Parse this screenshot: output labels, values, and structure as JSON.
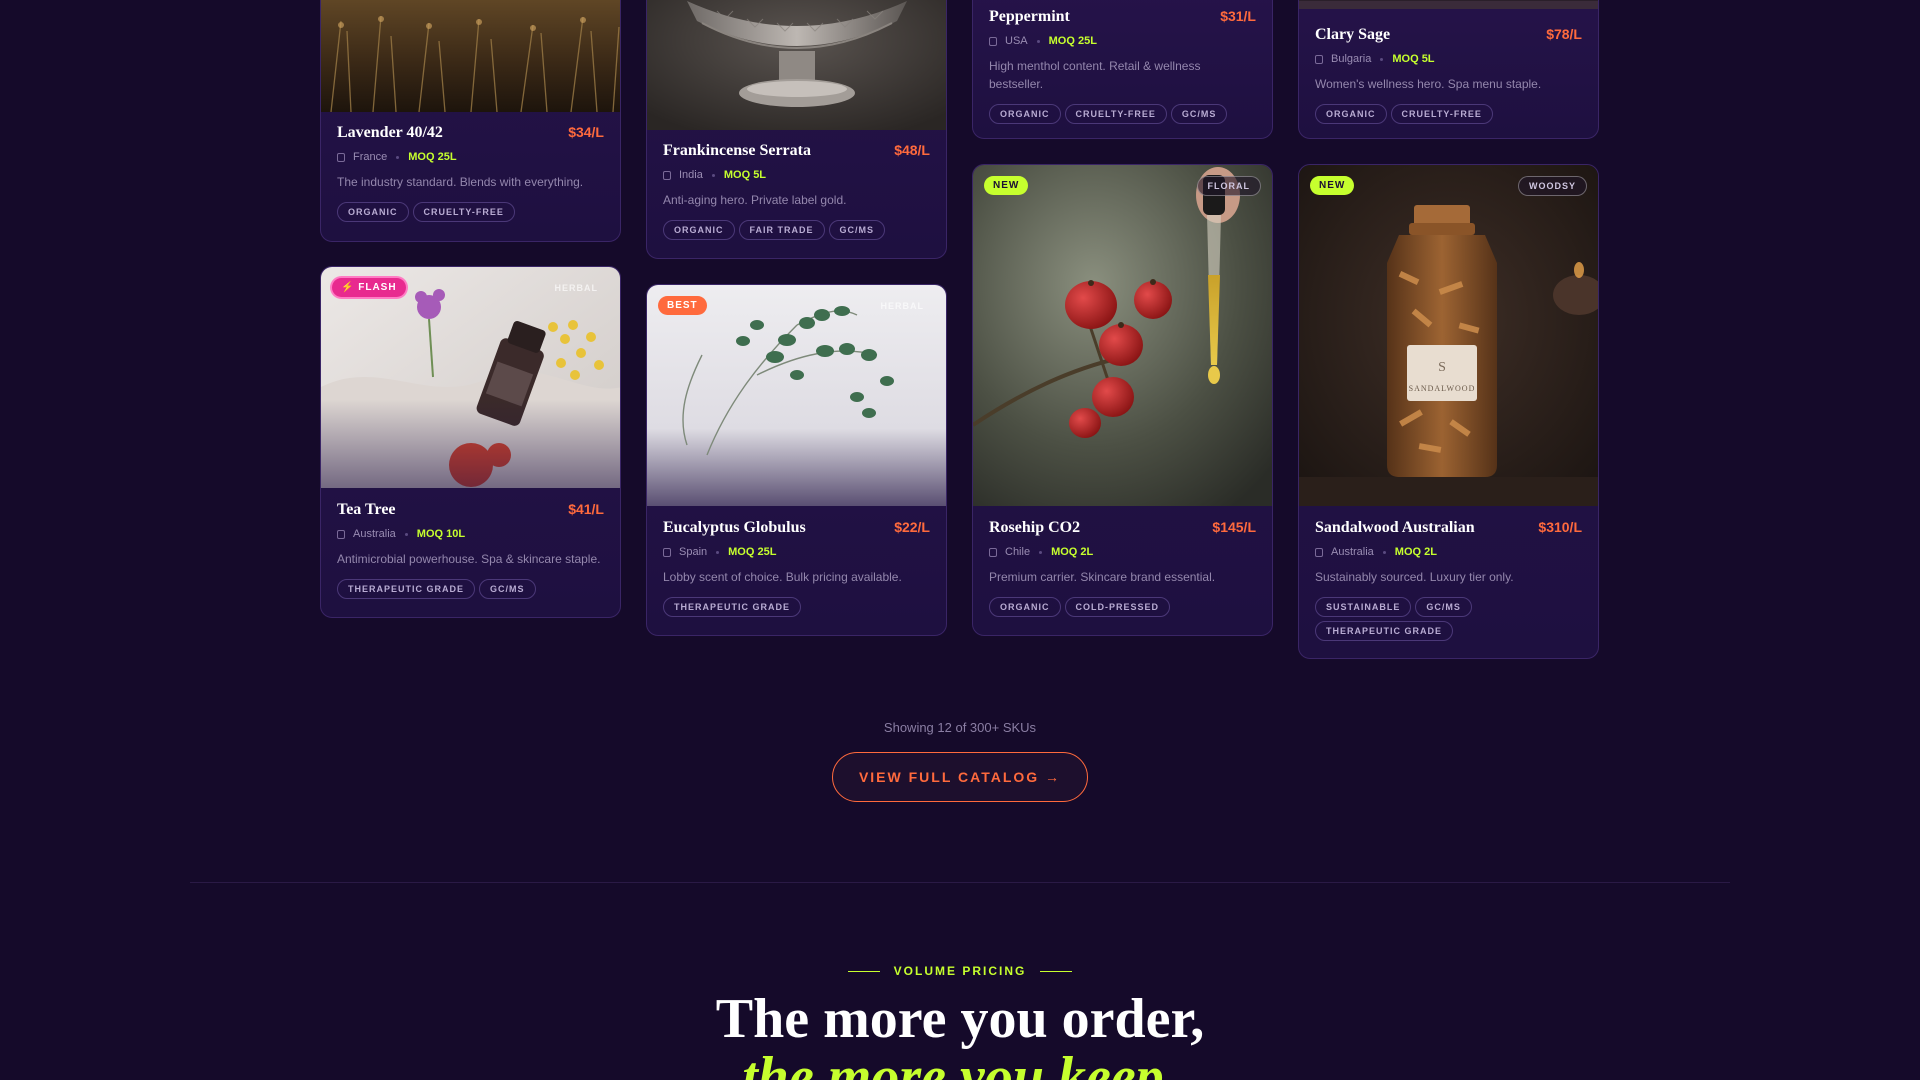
{
  "products": [
    {
      "name": "Lavender 40/42",
      "price": "$34/L",
      "origin": "France",
      "moq": "MOQ 25L",
      "desc": "The industry standard. Blends with everything.",
      "tags": [
        "ORGANIC",
        "CRUELTY-FREE"
      ]
    },
    {
      "name": "Frankincense Serrata",
      "price": "$48/L",
      "origin": "India",
      "moq": "MOQ 5L",
      "desc": "Anti-aging hero. Private label gold.",
      "tags": [
        "ORGANIC",
        "FAIR TRADE",
        "GC/MS"
      ]
    },
    {
      "name": "Peppermint",
      "price": "$31/L",
      "origin": "USA",
      "moq": "MOQ 25L",
      "desc": "High menthol content. Retail & wellness bestseller.",
      "tags": [
        "ORGANIC",
        "CRUELTY-FREE",
        "GC/MS"
      ]
    },
    {
      "name": "Clary Sage",
      "price": "$78/L",
      "origin": "Bulgaria",
      "moq": "MOQ 5L",
      "desc": "Women's wellness hero. Spa menu staple.",
      "tags": [
        "ORGANIC",
        "CRUELTY-FREE"
      ]
    },
    {
      "badge": "⚡ FLASH",
      "scent": "HERBAL",
      "name": "Tea Tree",
      "price": "$41/L",
      "origin": "Australia",
      "moq": "MOQ 10L",
      "desc": "Antimicrobial powerhouse. Spa & skincare staple.",
      "tags": [
        "THERAPEUTIC GRADE",
        "GC/MS"
      ]
    },
    {
      "badge": "BEST",
      "scent": "HERBAL",
      "name": "Eucalyptus Globulus",
      "price": "$22/L",
      "origin": "Spain",
      "moq": "MOQ 25L",
      "desc": "Lobby scent of choice. Bulk pricing available.",
      "tags": [
        "THERAPEUTIC GRADE"
      ]
    },
    {
      "badge": "NEW",
      "scent": "FLORAL",
      "name": "Rosehip CO2",
      "price": "$145/L",
      "origin": "Chile",
      "moq": "MOQ 2L",
      "desc": "Premium carrier. Skincare brand essential.",
      "tags": [
        "ORGANIC",
        "COLD-PRESSED"
      ]
    },
    {
      "badge": "NEW",
      "scent": "WOODSY",
      "name": "Sandalwood Australian",
      "price": "$310/L",
      "origin": "Australia",
      "moq": "MOQ 2L",
      "desc": "Sustainably sourced. Luxury tier only.",
      "tags": [
        "SUSTAINABLE",
        "GC/MS",
        "THERAPEUTIC GRADE"
      ],
      "label_text": "SANDALWOOD"
    }
  ],
  "catalog": {
    "showing": "Showing 12 of 300+ SKUs",
    "cta": "VIEW FULL CATALOG →"
  },
  "pricing": {
    "eyebrow": "VOLUME PRICING",
    "headline": "The more you order,",
    "headline_accent": "the more you keep."
  },
  "colors": {
    "background": "#150a2a",
    "card": "#26134a",
    "accent_lime": "#c6ff2e",
    "accent_orange": "#ff6a3d",
    "flash_pink": "#e82a8f"
  }
}
